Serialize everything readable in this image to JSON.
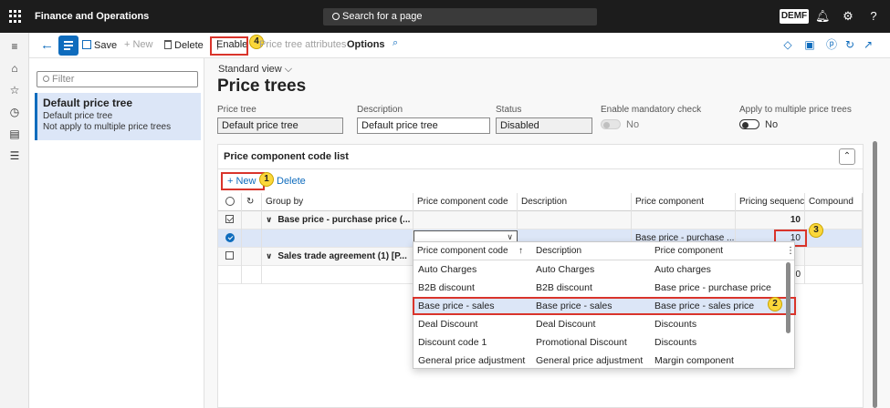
{
  "topbar": {
    "app_title": "Finance and Operations",
    "search_placeholder": "Search for a page",
    "company": "DEMF",
    "icons": [
      "bell-icon",
      "gear-icon",
      "help-icon"
    ]
  },
  "actions": {
    "save": "Save",
    "new": "New",
    "delete": "Delete",
    "enable": "Enable",
    "attributes": "Price tree attributes",
    "options": "Options"
  },
  "list": {
    "filter_placeholder": "Filter",
    "selected": {
      "title": "Default price tree",
      "line1": "Default price tree",
      "line2": "Not apply to multiple price trees"
    }
  },
  "page": {
    "view": "Standard view",
    "title": "Price trees"
  },
  "fields": {
    "price_tree": {
      "label": "Price tree",
      "value": "Default price tree"
    },
    "description": {
      "label": "Description",
      "value": "Default price tree"
    },
    "status": {
      "label": "Status",
      "value": "Disabled"
    },
    "mandatory": {
      "label": "Enable mandatory check",
      "value": "No"
    },
    "multiple": {
      "label": "Apply to multiple price trees",
      "value": "No"
    }
  },
  "section": {
    "title": "Price component code list",
    "new": "New",
    "delete": "Delete"
  },
  "grid": {
    "columns": [
      "Group by",
      "Price component code",
      "Description",
      "Price component",
      "Pricing sequence",
      "Compound"
    ],
    "rows": [
      {
        "group": "Base price - purchase price (...",
        "sequence": "10"
      },
      {
        "component": "Base price - purchase ...",
        "sequence": "10"
      },
      {
        "group": "Sales trade agreement (1) [P...",
        "sequence": "0"
      }
    ]
  },
  "dropdown": {
    "columns": [
      "Price component code",
      "Description",
      "Price component"
    ],
    "rows": [
      {
        "code": "Auto Charges",
        "description": "Auto Charges",
        "component": "Auto charges"
      },
      {
        "code": "B2B discount",
        "description": "B2B discount",
        "component": "Base price - purchase price"
      },
      {
        "code": "Base price - sales",
        "description": "Base price - sales",
        "component": "Base price - sales price"
      },
      {
        "code": "Deal Discount",
        "description": "Deal Discount",
        "component": "Discounts"
      },
      {
        "code": "Discount code 1",
        "description": "Promotional Discount",
        "component": "Discounts"
      },
      {
        "code": "General price adjustment",
        "description": "General price adjustment",
        "component": "Margin component"
      }
    ]
  },
  "callouts": [
    "1",
    "2",
    "3",
    "4"
  ]
}
